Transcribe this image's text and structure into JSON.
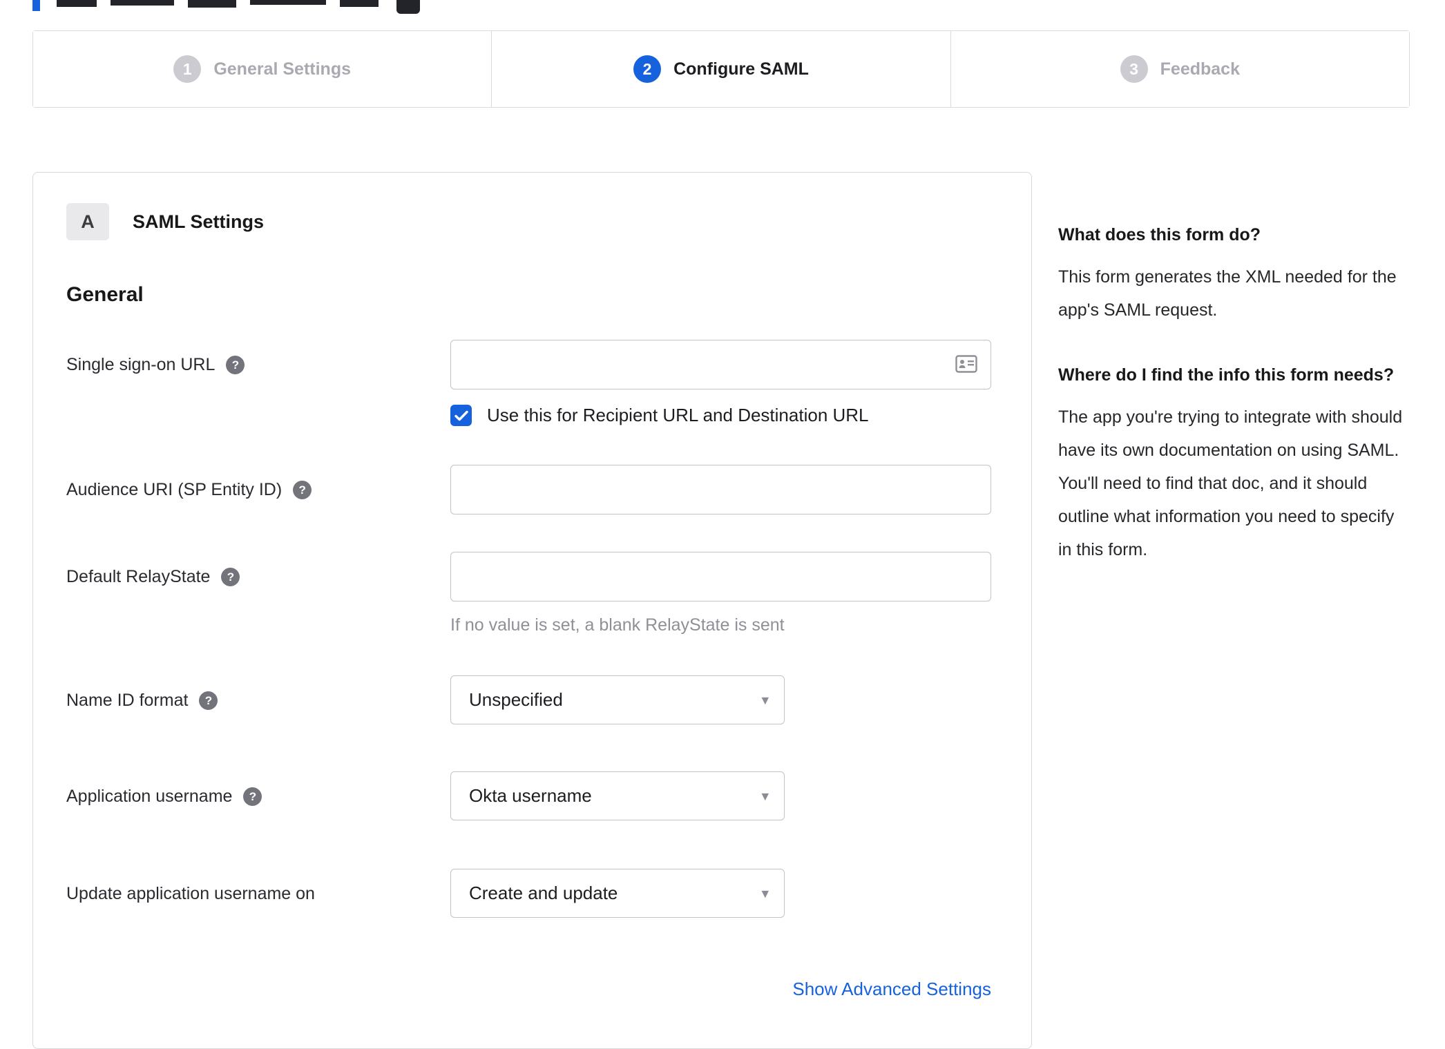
{
  "stepper": {
    "steps": [
      {
        "number": "1",
        "label": "General Settings"
      },
      {
        "number": "2",
        "label": "Configure SAML"
      },
      {
        "number": "3",
        "label": "Feedback"
      }
    ]
  },
  "panel": {
    "section_badge": "A",
    "section_title": "SAML Settings",
    "group_title": "General",
    "fields": {
      "sso_url": {
        "label": "Single sign-on URL",
        "value": ""
      },
      "sso_checkbox": {
        "label": "Use this for Recipient URL and Destination URL",
        "checked": true
      },
      "audience_uri": {
        "label": "Audience URI (SP Entity ID)",
        "value": ""
      },
      "relay_state": {
        "label": "Default RelayState",
        "value": "",
        "hint": "If no value is set, a blank RelayState is sent"
      },
      "name_id_format": {
        "label": "Name ID format",
        "value": "Unspecified"
      },
      "app_username": {
        "label": "Application username",
        "value": "Okta username"
      },
      "update_username": {
        "label": "Update application username on",
        "value": "Create and update"
      }
    },
    "advanced_link": "Show Advanced Settings"
  },
  "sidebar": {
    "sections": [
      {
        "heading": "What does this form do?",
        "body": "This form generates the XML needed for the app's SAML request."
      },
      {
        "heading": "Where do I find the info this form needs?",
        "body": "The app you're trying to integrate with should have its own documentation on using SAML. You'll need to find that doc, and it should outline what information you need to specify in this form."
      }
    ]
  },
  "icons": {
    "help": "?",
    "caret": "▾"
  },
  "colors": {
    "accent": "#1662dd",
    "link": "#1662dd",
    "checkbox": "#1662dd"
  }
}
